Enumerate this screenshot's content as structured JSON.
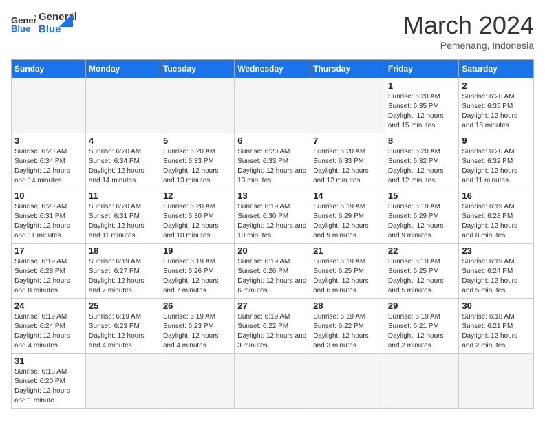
{
  "header": {
    "logo_general": "General",
    "logo_blue": "Blue",
    "month_title": "March 2024",
    "subtitle": "Pemenang, Indonesia"
  },
  "weekdays": [
    "Sunday",
    "Monday",
    "Tuesday",
    "Wednesday",
    "Thursday",
    "Friday",
    "Saturday"
  ],
  "rows": [
    [
      {
        "day": "",
        "info": ""
      },
      {
        "day": "",
        "info": ""
      },
      {
        "day": "",
        "info": ""
      },
      {
        "day": "",
        "info": ""
      },
      {
        "day": "",
        "info": ""
      },
      {
        "day": "1",
        "info": "Sunrise: 6:20 AM\nSunset: 6:35 PM\nDaylight: 12 hours and 15 minutes."
      },
      {
        "day": "2",
        "info": "Sunrise: 6:20 AM\nSunset: 6:35 PM\nDaylight: 12 hours and 15 minutes."
      }
    ],
    [
      {
        "day": "3",
        "info": "Sunrise: 6:20 AM\nSunset: 6:34 PM\nDaylight: 12 hours and 14 minutes."
      },
      {
        "day": "4",
        "info": "Sunrise: 6:20 AM\nSunset: 6:34 PM\nDaylight: 12 hours and 14 minutes."
      },
      {
        "day": "5",
        "info": "Sunrise: 6:20 AM\nSunset: 6:33 PM\nDaylight: 12 hours and 13 minutes."
      },
      {
        "day": "6",
        "info": "Sunrise: 6:20 AM\nSunset: 6:33 PM\nDaylight: 12 hours and 13 minutes."
      },
      {
        "day": "7",
        "info": "Sunrise: 6:20 AM\nSunset: 6:33 PM\nDaylight: 12 hours and 12 minutes."
      },
      {
        "day": "8",
        "info": "Sunrise: 6:20 AM\nSunset: 6:32 PM\nDaylight: 12 hours and 12 minutes."
      },
      {
        "day": "9",
        "info": "Sunrise: 6:20 AM\nSunset: 6:32 PM\nDaylight: 12 hours and 11 minutes."
      }
    ],
    [
      {
        "day": "10",
        "info": "Sunrise: 6:20 AM\nSunset: 6:31 PM\nDaylight: 12 hours and 11 minutes."
      },
      {
        "day": "11",
        "info": "Sunrise: 6:20 AM\nSunset: 6:31 PM\nDaylight: 12 hours and 11 minutes."
      },
      {
        "day": "12",
        "info": "Sunrise: 6:20 AM\nSunset: 6:30 PM\nDaylight: 12 hours and 10 minutes."
      },
      {
        "day": "13",
        "info": "Sunrise: 6:19 AM\nSunset: 6:30 PM\nDaylight: 12 hours and 10 minutes."
      },
      {
        "day": "14",
        "info": "Sunrise: 6:19 AM\nSunset: 6:29 PM\nDaylight: 12 hours and 9 minutes."
      },
      {
        "day": "15",
        "info": "Sunrise: 6:19 AM\nSunset: 6:29 PM\nDaylight: 12 hours and 9 minutes."
      },
      {
        "day": "16",
        "info": "Sunrise: 6:19 AM\nSunset: 6:28 PM\nDaylight: 12 hours and 8 minutes."
      }
    ],
    [
      {
        "day": "17",
        "info": "Sunrise: 6:19 AM\nSunset: 6:28 PM\nDaylight: 12 hours and 8 minutes."
      },
      {
        "day": "18",
        "info": "Sunrise: 6:19 AM\nSunset: 6:27 PM\nDaylight: 12 hours and 7 minutes."
      },
      {
        "day": "19",
        "info": "Sunrise: 6:19 AM\nSunset: 6:26 PM\nDaylight: 12 hours and 7 minutes."
      },
      {
        "day": "20",
        "info": "Sunrise: 6:19 AM\nSunset: 6:26 PM\nDaylight: 12 hours and 6 minutes."
      },
      {
        "day": "21",
        "info": "Sunrise: 6:19 AM\nSunset: 6:25 PM\nDaylight: 12 hours and 6 minutes."
      },
      {
        "day": "22",
        "info": "Sunrise: 6:19 AM\nSunset: 6:25 PM\nDaylight: 12 hours and 5 minutes."
      },
      {
        "day": "23",
        "info": "Sunrise: 6:19 AM\nSunset: 6:24 PM\nDaylight: 12 hours and 5 minutes."
      }
    ],
    [
      {
        "day": "24",
        "info": "Sunrise: 6:19 AM\nSunset: 6:24 PM\nDaylight: 12 hours and 4 minutes."
      },
      {
        "day": "25",
        "info": "Sunrise: 6:19 AM\nSunset: 6:23 PM\nDaylight: 12 hours and 4 minutes."
      },
      {
        "day": "26",
        "info": "Sunrise: 6:19 AM\nSunset: 6:23 PM\nDaylight: 12 hours and 4 minutes."
      },
      {
        "day": "27",
        "info": "Sunrise: 6:19 AM\nSunset: 6:22 PM\nDaylight: 12 hours and 3 minutes."
      },
      {
        "day": "28",
        "info": "Sunrise: 6:19 AM\nSunset: 6:22 PM\nDaylight: 12 hours and 3 minutes."
      },
      {
        "day": "29",
        "info": "Sunrise: 6:19 AM\nSunset: 6:21 PM\nDaylight: 12 hours and 2 minutes."
      },
      {
        "day": "30",
        "info": "Sunrise: 6:18 AM\nSunset: 6:21 PM\nDaylight: 12 hours and 2 minutes."
      }
    ],
    [
      {
        "day": "31",
        "info": "Sunrise: 6:18 AM\nSunset: 6:20 PM\nDaylight: 12 hours and 1 minute."
      },
      {
        "day": "",
        "info": ""
      },
      {
        "day": "",
        "info": ""
      },
      {
        "day": "",
        "info": ""
      },
      {
        "day": "",
        "info": ""
      },
      {
        "day": "",
        "info": ""
      },
      {
        "day": "",
        "info": ""
      }
    ]
  ]
}
